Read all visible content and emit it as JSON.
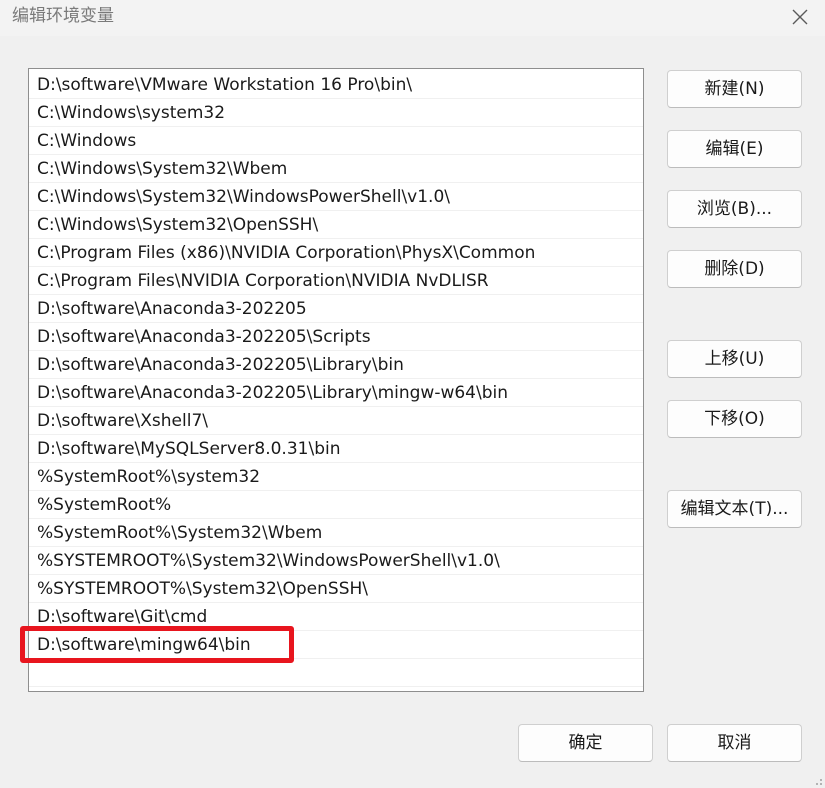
{
  "window": {
    "title": "编辑环境变量"
  },
  "path_list": {
    "items": [
      "D:\\software\\VMware Workstation 16 Pro\\bin\\",
      "C:\\Windows\\system32",
      "C:\\Windows",
      "C:\\Windows\\System32\\Wbem",
      "C:\\Windows\\System32\\WindowsPowerShell\\v1.0\\",
      "C:\\Windows\\System32\\OpenSSH\\",
      "C:\\Program Files (x86)\\NVIDIA Corporation\\PhysX\\Common",
      "C:\\Program Files\\NVIDIA Corporation\\NVIDIA NvDLISR",
      "D:\\software\\Anaconda3-202205",
      "D:\\software\\Anaconda3-202205\\Scripts",
      "D:\\software\\Anaconda3-202205\\Library\\bin",
      "D:\\software\\Anaconda3-202205\\Library\\mingw-w64\\bin",
      "D:\\software\\Xshell7\\",
      "D:\\software\\MySQLServer8.0.31\\bin",
      "%SystemRoot%\\system32",
      "%SystemRoot%",
      "%SystemRoot%\\System32\\Wbem",
      "%SYSTEMROOT%\\System32\\WindowsPowerShell\\v1.0\\",
      "%SYSTEMROOT%\\System32\\OpenSSH\\",
      "D:\\software\\Git\\cmd",
      "D:\\software\\mingw64\\bin",
      ""
    ],
    "highlighted_item": "D:\\software\\mingw64\\bin"
  },
  "buttons": {
    "new": "新建(N)",
    "edit": "编辑(E)",
    "browse": "浏览(B)...",
    "delete": "删除(D)",
    "move_up": "上移(U)",
    "move_down": "下移(O)",
    "edit_text": "编辑文本(T)...",
    "ok": "确定",
    "cancel": "取消"
  },
  "icons": {
    "close": "close-icon"
  },
  "colors": {
    "highlight_border": "#e8151e"
  }
}
